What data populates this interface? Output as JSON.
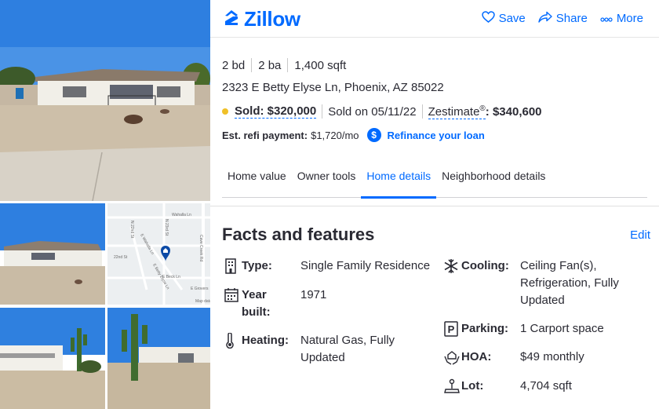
{
  "brand": {
    "name": "Zillow",
    "color": "#006aff"
  },
  "header_actions": [
    {
      "label": "Save",
      "icon": "heart-icon"
    },
    {
      "label": "Share",
      "icon": "share-icon"
    },
    {
      "label": "More",
      "icon": "more-dots-icon"
    }
  ],
  "home": {
    "beds": "2 bd",
    "baths": "2 ba",
    "sqft": "1,400 sqft",
    "address": "2323 E Betty Elyse Ln, Phoenix, AZ 85022",
    "sold_label": "Sold: $320,000",
    "sold_on": "Sold on 05/11/22",
    "zestimate_label": "Zestimate",
    "zestimate_mark": "®",
    "zestimate_value": ": $340,600",
    "refi_label": "Est. refi payment:",
    "refi_value": "$1,720/mo",
    "refi_link": "Refinance your loan"
  },
  "tabs": [
    "Home value",
    "Owner tools",
    "Home details",
    "Neighborhood details"
  ],
  "active_tab": "Home details",
  "facts": {
    "title": "Facts and features",
    "edit": "Edit",
    "left": [
      {
        "label": "Type:",
        "value": "Single Family Residence",
        "icon": "building-icon"
      },
      {
        "label": "Year built:",
        "value": "1971",
        "icon": "calendar-icon"
      },
      {
        "label": "Heating:",
        "value": "Natural Gas, Fully Updated",
        "icon": "thermometer-icon"
      }
    ],
    "right": [
      {
        "label": "Cooling:",
        "value": "Ceiling Fan(s), Refrigeration, Fully Updated",
        "icon": "snowflake-icon"
      },
      {
        "label": "Parking:",
        "value": "1 Carport space",
        "icon": "parking-icon"
      },
      {
        "label": "HOA:",
        "value": "$49 monthly",
        "icon": "hoa-hands-icon"
      },
      {
        "label": "Lot:",
        "value": "4,704 sqft",
        "icon": "lot-icon"
      }
    ]
  },
  "map": {
    "streets": [
      "Wahalla Ln",
      "E Wahalla Ln",
      "E Betty Elyse Ln",
      "N 23rd St",
      "N 22nd St",
      "Cave Creek Rd",
      "22nd St",
      "E Beck Ln",
      "E Grovers",
      "Map data"
    ]
  },
  "colors": {
    "sold_dot": "#f0c028",
    "text": "#2a2a33"
  }
}
